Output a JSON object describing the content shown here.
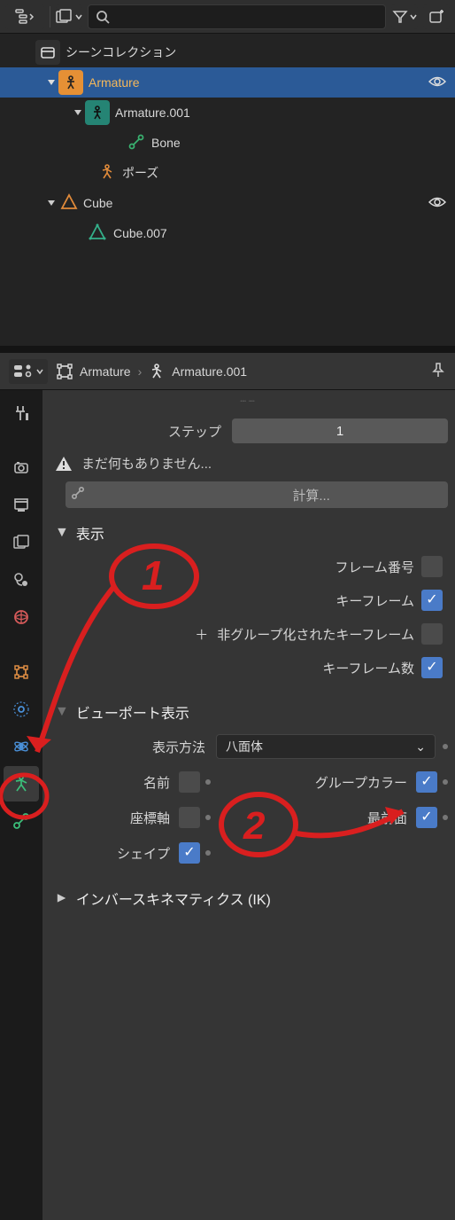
{
  "outliner": {
    "scene_collection": "シーンコレクション",
    "items": [
      {
        "label": "Armature"
      },
      {
        "label": "Armature.001"
      },
      {
        "label": "Bone"
      },
      {
        "label": "ポーズ"
      },
      {
        "label": "Cube"
      },
      {
        "label": "Cube.007"
      }
    ]
  },
  "props": {
    "breadcrumb": {
      "obj": "Armature",
      "data": "Armature.001"
    },
    "step_label": "ステップ",
    "step_value": "1",
    "warning_text": "まだ何もありません...",
    "compute_btn": "計算...",
    "display_panel": "表示",
    "checks": {
      "frame_number": "フレーム番号",
      "keyframe": "キーフレーム",
      "ungrouped_keyframe": "非グループ化されたキーフレーム",
      "keyframe_count": "キーフレーム数"
    },
    "viewport_panel": "ビューポート表示",
    "display_as_label": "表示方法",
    "display_as_value": "八面体",
    "row1": {
      "name": "名前",
      "group_color": "グループカラー"
    },
    "row2": {
      "axes": "座標軸",
      "in_front": "最前面"
    },
    "row3": {
      "shape": "シェイプ"
    },
    "ik_panel": "インバースキネマティクス (IK)"
  },
  "annotations": {
    "one": "1",
    "two": "2"
  }
}
